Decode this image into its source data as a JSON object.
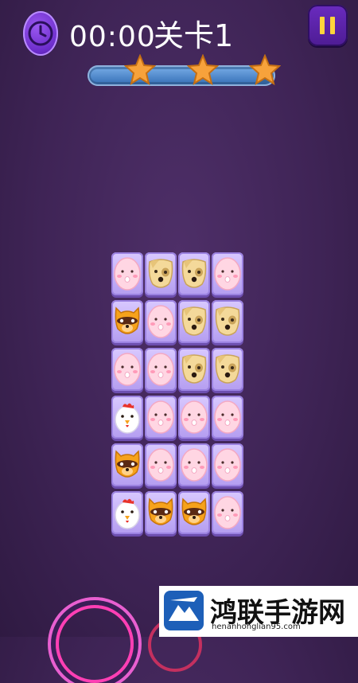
{
  "hud": {
    "timer": "00:00",
    "level_title": "关卡1",
    "progress": 0.94,
    "stars_count": 3,
    "icons": {
      "clock": "clock-icon",
      "pause": "pause-icon",
      "star": "star-icon"
    }
  },
  "board": {
    "rows": 6,
    "cols": 4,
    "tiles": [
      [
        "pig",
        "dog",
        "dog",
        "pig"
      ],
      [
        "raccoon",
        "pig",
        "dog",
        "dog"
      ],
      [
        "pig",
        "pig",
        "dog",
        "dog"
      ],
      [
        "chicken",
        "pig",
        "pig",
        "pig"
      ],
      [
        "raccoon",
        "pig",
        "pig",
        "pig"
      ],
      [
        "chicken",
        "raccoon",
        "raccoon",
        "pig"
      ]
    ]
  },
  "watermark": {
    "title": "鸿联手游网",
    "url": "henanhonglian95.com"
  },
  "colors": {
    "accent_purple": "#6a2bc9",
    "pause_bar": "#ffd43b",
    "star": "#f7a23b",
    "progress_track": "#2e5d96"
  }
}
